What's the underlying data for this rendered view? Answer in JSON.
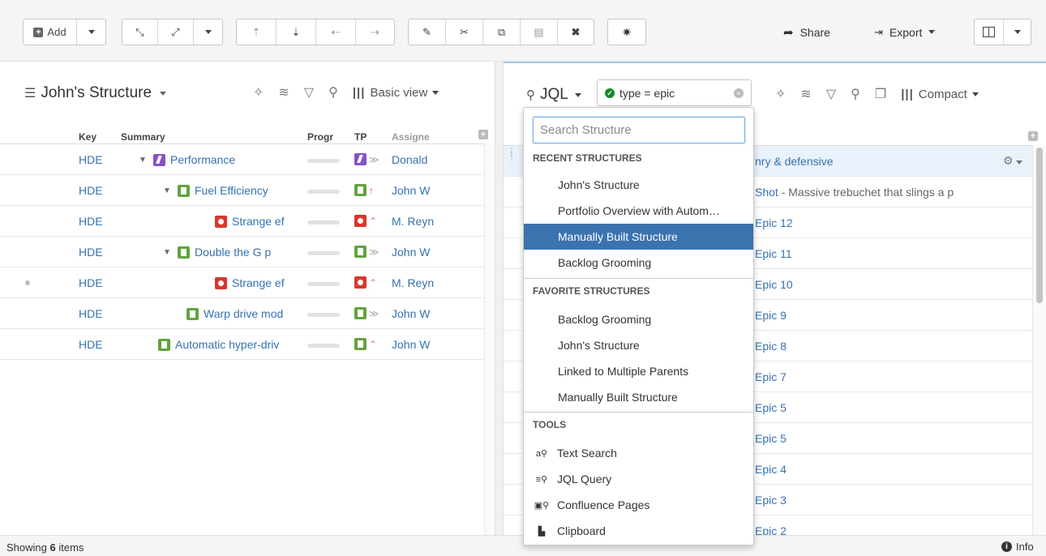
{
  "toolbar": {
    "add_label": "Add",
    "share_label": "Share",
    "export_label": "Export"
  },
  "left_panel": {
    "title": "John's Structure",
    "view_label": "Basic view",
    "columns": {
      "key": "Key",
      "summary": "Summary",
      "progress": "Progr",
      "tp": "TP",
      "assignee": "Assigne"
    },
    "rows": [
      {
        "key": "HDE",
        "summary": "Performance",
        "type": "epic",
        "priority": "≫",
        "assignee": "Donald",
        "toggle": "▼"
      },
      {
        "key": "HDE",
        "summary": "Fuel Efficiency",
        "type": "story",
        "priority": "↑",
        "assignee": "John W",
        "toggle": "▼"
      },
      {
        "key": "HDE",
        "summary": "Strange ef",
        "type": "bug",
        "priority": "⌃",
        "assignee": "M. Reyn",
        "toggle": ""
      },
      {
        "key": "HDE",
        "summary": "Double the G p",
        "type": "story",
        "priority": "≫",
        "assignee": "John W",
        "toggle": "▼"
      },
      {
        "key": "HDE",
        "summary": "Strange ef",
        "type": "bug",
        "priority": "⌃",
        "assignee": "M. Reyn",
        "toggle": ""
      },
      {
        "key": "HDE",
        "summary": "Warp drive mod",
        "type": "story",
        "priority": "≫",
        "assignee": "John W",
        "toggle": ""
      },
      {
        "key": "HDE",
        "summary": "Automatic hyper-driv",
        "type": "story",
        "priority": "⌃",
        "assignee": "John W",
        "toggle": ""
      }
    ]
  },
  "right_panel": {
    "jql_label": "JQL",
    "query_value": "type = epic",
    "view_label": "Compact",
    "rows": [
      {
        "text": "nry & defensive"
      },
      {
        "text": "Shot",
        "suffix": " - Massive trebuchet that slings a p"
      },
      {
        "text": "Epic 12"
      },
      {
        "text": "Epic 11"
      },
      {
        "text": "Epic 10"
      },
      {
        "text": "Epic 9"
      },
      {
        "text": "Epic 8"
      },
      {
        "text": "Epic 7"
      },
      {
        "text": "Epic 5"
      },
      {
        "text": "Epic 5"
      },
      {
        "text": "Epic 4"
      },
      {
        "text": "Epic 3"
      },
      {
        "text": "Epic 2"
      }
    ]
  },
  "dropdown": {
    "search_placeholder": "Search Structure",
    "recent_header": "RECENT STRUCTURES",
    "recent": [
      {
        "label": "John's Structure"
      },
      {
        "label": "Portfolio Overview with Autom…"
      },
      {
        "label": "Manually Built Structure",
        "selected": true
      },
      {
        "label": "Backlog Grooming"
      }
    ],
    "favorite_header": "FAVORITE STRUCTURES",
    "favorites": [
      {
        "label": "Backlog Grooming"
      },
      {
        "label": "John's Structure"
      },
      {
        "label": "Linked to Multiple Parents"
      },
      {
        "label": "Manually Built Structure"
      }
    ],
    "tools_header": "TOOLS",
    "tools": [
      {
        "label": "Text Search",
        "icon": "text-search-icon"
      },
      {
        "label": "JQL Query",
        "icon": "jql-query-icon"
      },
      {
        "label": "Confluence Pages",
        "icon": "confluence-icon"
      },
      {
        "label": "Clipboard",
        "icon": "clipboard-icon"
      }
    ]
  },
  "status": {
    "showing_prefix": "Showing",
    "showing_count": "6",
    "showing_suffix": "items",
    "info_label": "Info"
  },
  "colors": {
    "link": "#3572b0",
    "selected_bg": "#3b73af",
    "epic": "#8652c7",
    "story": "#62a33e",
    "bug": "#d9372e"
  }
}
